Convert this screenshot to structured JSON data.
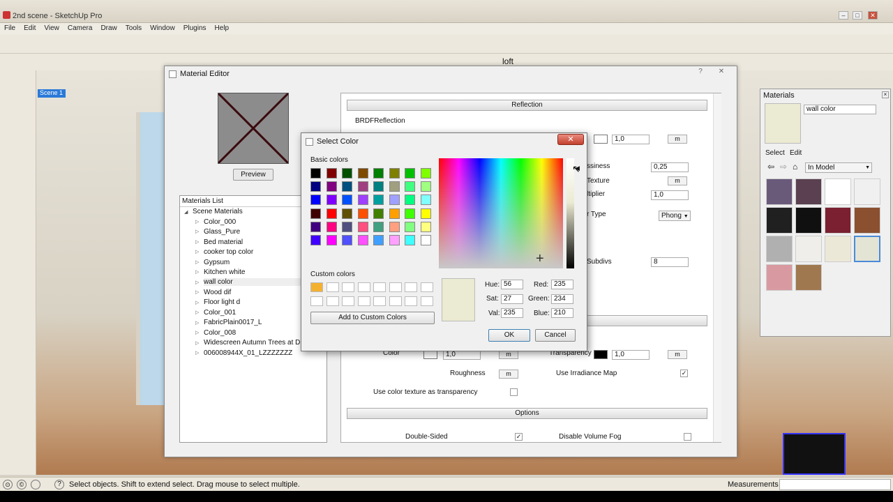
{
  "window": {
    "title": "2nd scene - SketchUp Pro",
    "min": "–",
    "max": "□",
    "close": "✕"
  },
  "menu": [
    "File",
    "Edit",
    "View",
    "Camera",
    "Draw",
    "Tools",
    "Window",
    "Plugins",
    "Help"
  ],
  "scene_tab": "Scene 1",
  "toolbar_text": {
    "loft": "loft"
  },
  "status": {
    "text": "Select objects. Shift to extend select. Drag mouse to select multiple.",
    "measurements": "Measurements"
  },
  "material_editor": {
    "title": "Material Editor",
    "help": "?",
    "close": "✕",
    "preview_label": "Preview",
    "materials_list_header": "Materials List",
    "tree_root": "Scene Materials",
    "materials": [
      "Color_000",
      "Glass_Pure",
      "Bed material",
      "cooker top color",
      "Gypsum",
      "Kitchen white",
      "wall color",
      "Wood dif",
      "Floor light d",
      "Color_001",
      "FabricPlain0017_L",
      "Color_008",
      "Widescreen Autumn Trees at Dus",
      "006008944X_01_LZZZZZZZ"
    ],
    "selected_material": "wall color",
    "reflection_header": "Reflection",
    "brdf_label": "BRDFReflection",
    "refl_value": "1,0",
    "glossiness_label": "ssiness",
    "glossiness_value": "0,25",
    "texture_label": "Texture",
    "multiplier_label": "ltiplier",
    "multiplier_value": "1,0",
    "type_label": "r Type",
    "type_value": "Phong",
    "subdivs_label": "Subdivs",
    "subdivs_value": "8",
    "color_label": "Color",
    "color_value": "1,0",
    "transparency_label": "Transparency",
    "transparency_value": "1,0",
    "roughness_label": "Roughness",
    "use_irradiance_label": "Use Irradiance Map",
    "use_color_tex_label": "Use color texture as transparency",
    "options_header": "Options",
    "double_sided_label": "Double-Sided",
    "disable_fog_label": "Disable Volume Fog",
    "m": "m"
  },
  "select_color": {
    "title": "Select Color",
    "close": "✕",
    "basic_colors_label": "Basic colors",
    "custom_colors_label": "Custom colors",
    "basic_colors": [
      "#000000",
      "#800000",
      "#005000",
      "#7f4a00",
      "#008000",
      "#808000",
      "#00c000",
      "#80ff00",
      "#000080",
      "#800080",
      "#005080",
      "#a04080",
      "#008080",
      "#a0a080",
      "#40ff80",
      "#a0ff80",
      "#0000ff",
      "#8000ff",
      "#0050ff",
      "#a040ff",
      "#00a0a0",
      "#a0a0ff",
      "#00ff80",
      "#80ffff",
      "#400000",
      "#ff0000",
      "#605000",
      "#ff5000",
      "#408000",
      "#ffa000",
      "#40ff00",
      "#ffff00",
      "#400080",
      "#ff0080",
      "#505080",
      "#ff5080",
      "#40a080",
      "#ffa080",
      "#80ff80",
      "#ffff80",
      "#4000ff",
      "#ff00ff",
      "#5050ff",
      "#ff50ff",
      "#40a0ff",
      "#ffa0ff",
      "#40ffff",
      "#ffffff"
    ],
    "custom_first_color": "#f4b130",
    "hue_label": "Hue:",
    "hue": "56",
    "sat_label": "Sat:",
    "sat": "27",
    "val_label": "Val:",
    "val": "235",
    "red_label": "Red:",
    "red": "235",
    "green_label": "Green:",
    "green": "234",
    "blue_label": "Blue:",
    "blue": "210",
    "add_custom_label": "Add to Custom Colors",
    "ok_label": "OK",
    "cancel_label": "Cancel",
    "current_color": "#ebead2"
  },
  "materials_panel": {
    "title": "Materials",
    "name_value": "wall color",
    "tab_select": "Select",
    "tab_edit": "Edit",
    "dropdown_value": "In Model",
    "thumbs": [
      "#6a5a7a",
      "#5a4050",
      "#ffffff",
      "#f0f0f0",
      "#202020",
      "#101010",
      "#7a2030",
      "#8a5030",
      "#b0b0b0",
      "#f0eeea",
      "#ece8d8",
      "#e4e4d4",
      "#d89aa0",
      "#a07850"
    ]
  }
}
